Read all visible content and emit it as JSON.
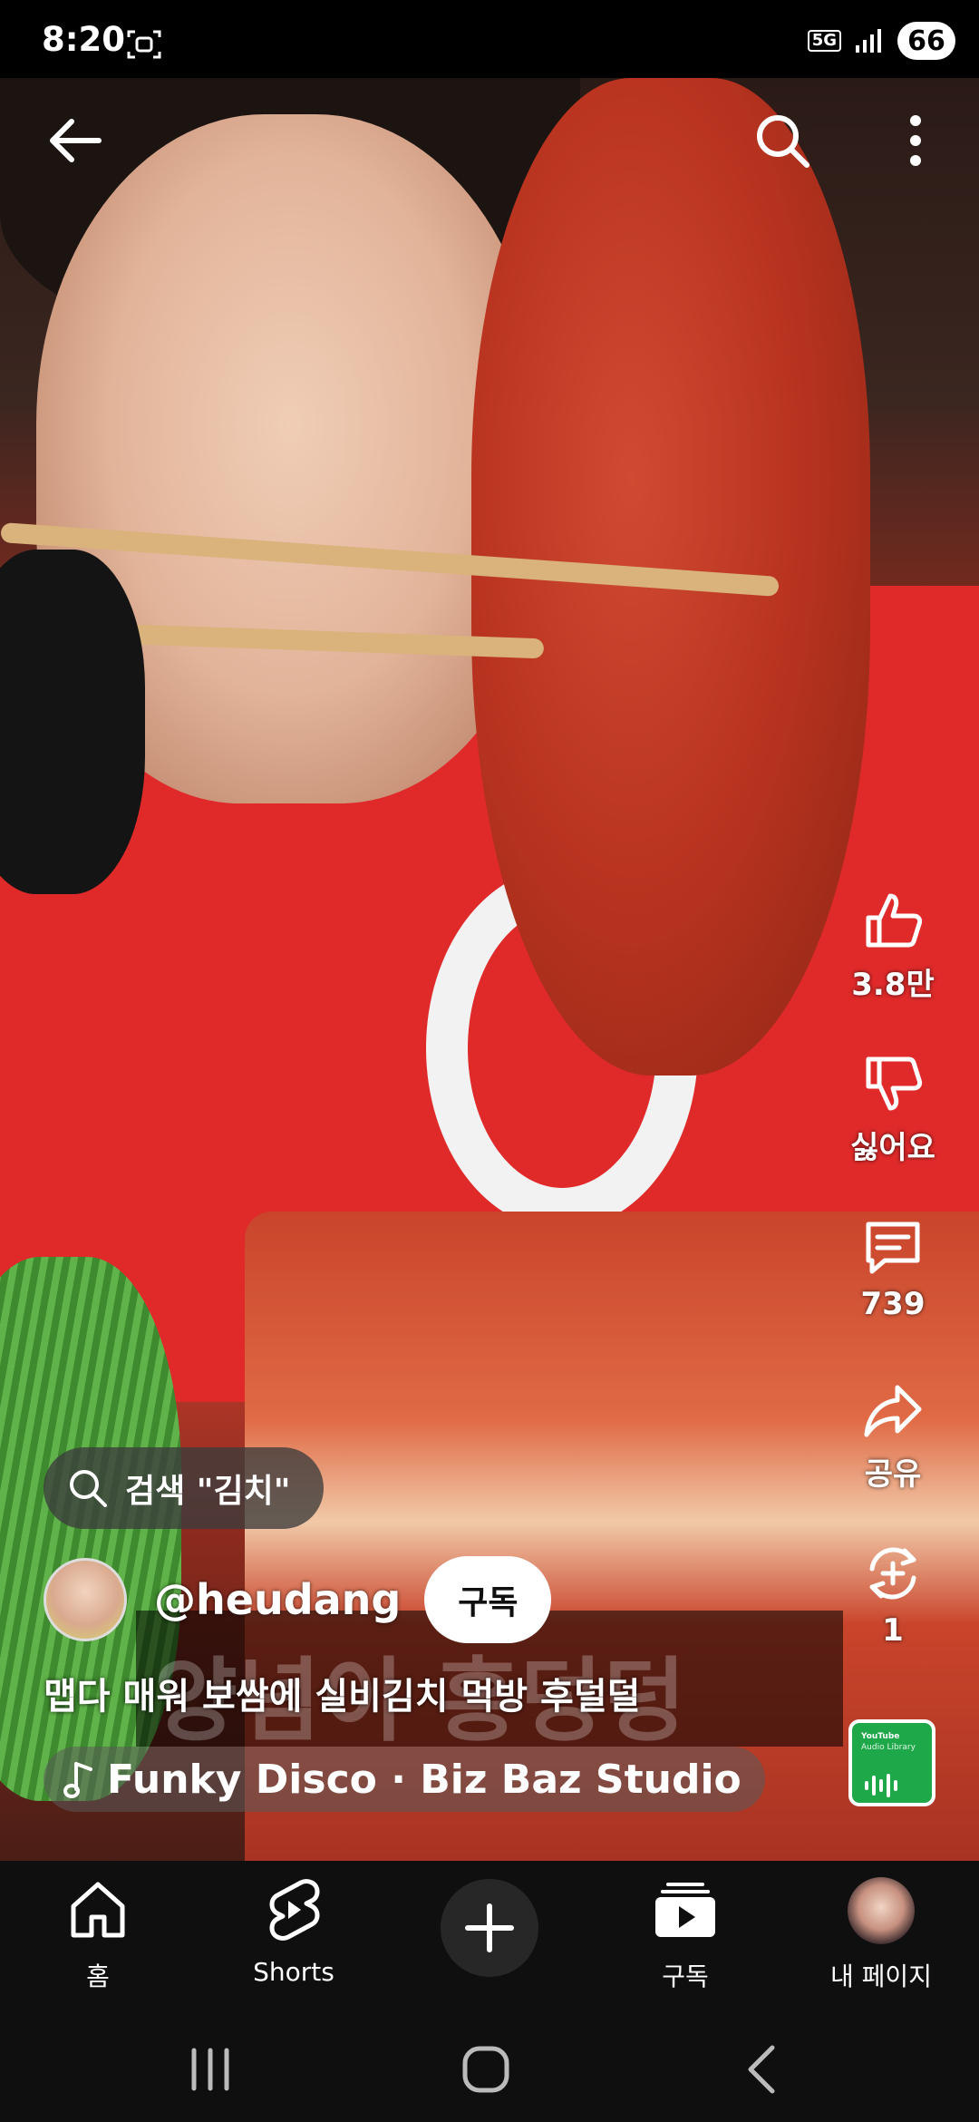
{
  "status_bar": {
    "time": "8:20",
    "network": "5G",
    "battery": "66"
  },
  "top_bar": {
    "icons": [
      "back-arrow-icon",
      "search-icon",
      "more-vert-icon"
    ]
  },
  "actions": {
    "like_count": "3.8만",
    "dislike_label": "싫어요",
    "comment_count": "739",
    "share_label": "공유",
    "remix_count": "1"
  },
  "search_chip": {
    "label": "검색 \"김치\""
  },
  "channel": {
    "handle": "@heudang",
    "subscribe_label": "구독"
  },
  "video": {
    "title": "맵다 매워 보쌈에 실비김치 먹방 후덜덜",
    "caption_overlay": "양념이 흥덩덩"
  },
  "music": {
    "label": "Funky Disco · Biz Baz Studio"
  },
  "audio_thumb": {
    "line1": "YouTube",
    "line2": "Audio Library"
  },
  "bottom_nav": {
    "home_label": "홈",
    "shorts_label": "Shorts",
    "subscriptions_label": "구독",
    "you_label": "내 페이지"
  },
  "colors": {
    "accent_white": "#ffffff",
    "nav_bg": "#0f0f0f",
    "audio_thumb_green": "#1fa84a"
  }
}
